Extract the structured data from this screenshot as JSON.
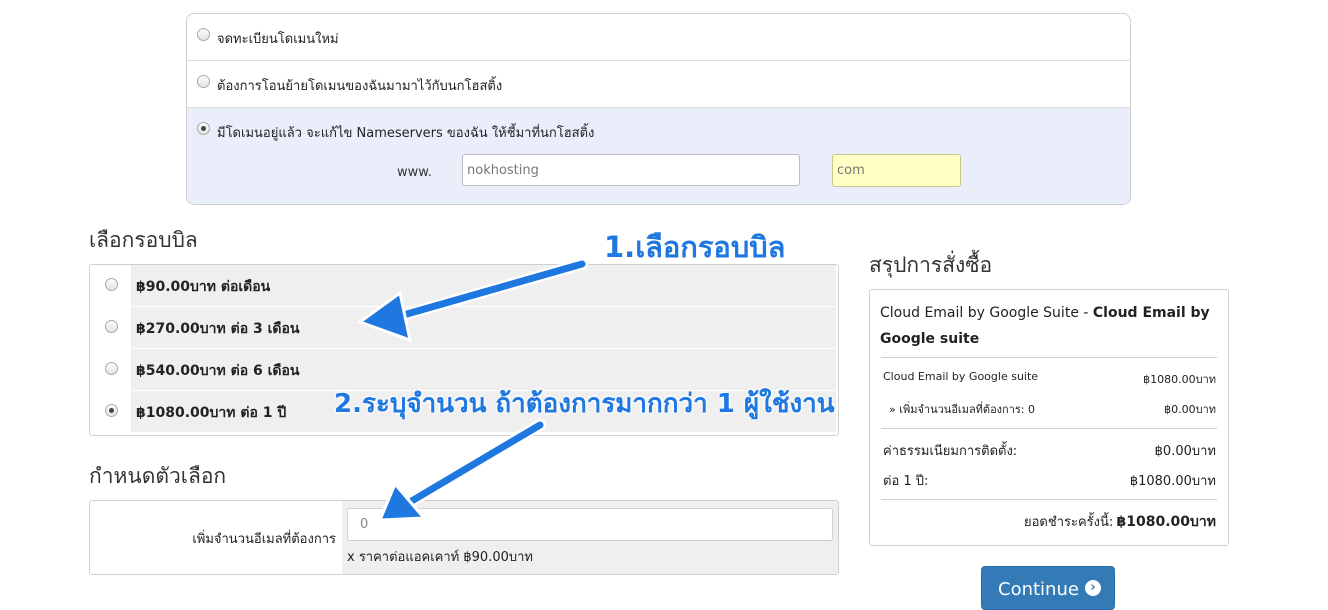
{
  "domain_options": {
    "register_new": "จดทะเบียนโดเมนใหม่",
    "transfer": "ต้องการโอนย้ายโดเมนของฉันมามาไว้กับนกโฮสติ้ง",
    "use_existing": "มีโดเมนอยู่แล้ว จะแก้ไข Nameservers ของฉัน ให้ชี้มาที่นกโฮสติ้ง",
    "selected_index": 2,
    "www_label": "www.",
    "sld_value": "nokhosting",
    "tld_value": "com"
  },
  "billing": {
    "title": "เลือกรอบบิล",
    "options": [
      {
        "label": "฿90.00บาท ต่อเดือน",
        "selected": false
      },
      {
        "label": "฿270.00บาท ต่อ 3 เดือน",
        "selected": false
      },
      {
        "label": "฿540.00บาท ต่อ 6 เดือน",
        "selected": false
      },
      {
        "label": "฿1080.00บาท ต่อ 1 ปี",
        "selected": true
      }
    ]
  },
  "config": {
    "title": "กำหนดตัวเลือก",
    "qty_label": "เพิ่มจำนวนอีเมลที่ต้องการ",
    "qty_value": "0",
    "qty_note": "x ราคาต่อแอคเคาท์ ฿90.00บาท"
  },
  "summary": {
    "title": "สรุปการสั่งซื้อ",
    "product_group": "Cloud Email by Google Suite",
    "separator": " - ",
    "product_name": "Cloud Email by Google suite",
    "line1_label": "Cloud Email by Google suite",
    "line1_value": "฿1080.00บาท",
    "line2_label": "» เพิ่มจำนวนอีเมลที่ต้องการ: 0",
    "line2_value": "฿0.00บาท",
    "setup_label": "ค่าธรรมเนียมการติดตั้ง:",
    "setup_value": "฿0.00บาท",
    "cycle_label": "ต่อ 1 ปี:",
    "cycle_value": "฿1080.00บาท",
    "total_label": "ยอดชำระครั้งนี้:",
    "total_value": "฿1080.00บาท"
  },
  "continue_label": "Continue",
  "annotations": {
    "step1": "1.เลือกรอบบิล",
    "step2": "2.ระบุจำนวน ถ้าต้องการมากกว่า 1 ผู้ใช้งาน",
    "color": "#1e78e0"
  },
  "colors": {
    "primary": "#337ab7",
    "selected_row_bg": "#eaeefb",
    "tld_bg": "#ffffc4",
    "cell_bg": "#efefef"
  }
}
